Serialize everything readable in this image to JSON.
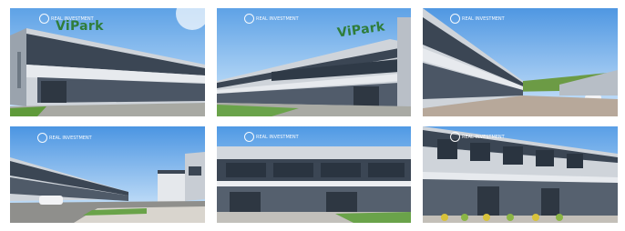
{
  "gallery": {
    "photos": [
      {
        "id": "photo-1",
        "brand": "ViPark",
        "logo": "REAL INVESTMENT"
      },
      {
        "id": "photo-2",
        "brand": "ViPark",
        "logo": "REAL INVESTMENT"
      },
      {
        "id": "photo-3",
        "brand": "",
        "logo": "REAL INVESTMENT"
      },
      {
        "id": "photo-4",
        "brand": "",
        "logo": "REAL INVESTMENT"
      },
      {
        "id": "photo-5",
        "brand": "",
        "logo": "REAL INVESTMENT"
      },
      {
        "id": "photo-6",
        "brand": "",
        "logo": "REAL INVESTMENT"
      }
    ]
  },
  "colors": {
    "sky": "#7fb6ea",
    "facade": "#c9ced6",
    "band": "#2c3440",
    "glass": "#3d4a5a",
    "grass": "#5f9a3a",
    "brand": "#2f7d3a"
  }
}
